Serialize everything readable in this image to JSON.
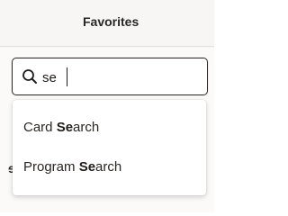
{
  "header": {
    "title": "Favorites"
  },
  "search": {
    "value": "se",
    "placeholder": ""
  },
  "results": [
    {
      "before": "Card ",
      "match": "Se",
      "after": "arch"
    },
    {
      "before": "Program ",
      "match": "Se",
      "after": "arch"
    }
  ],
  "background": {
    "partial_text": "ɘ"
  },
  "colors": {
    "accent_border": "#2e2a27",
    "text": "#2a2623"
  }
}
